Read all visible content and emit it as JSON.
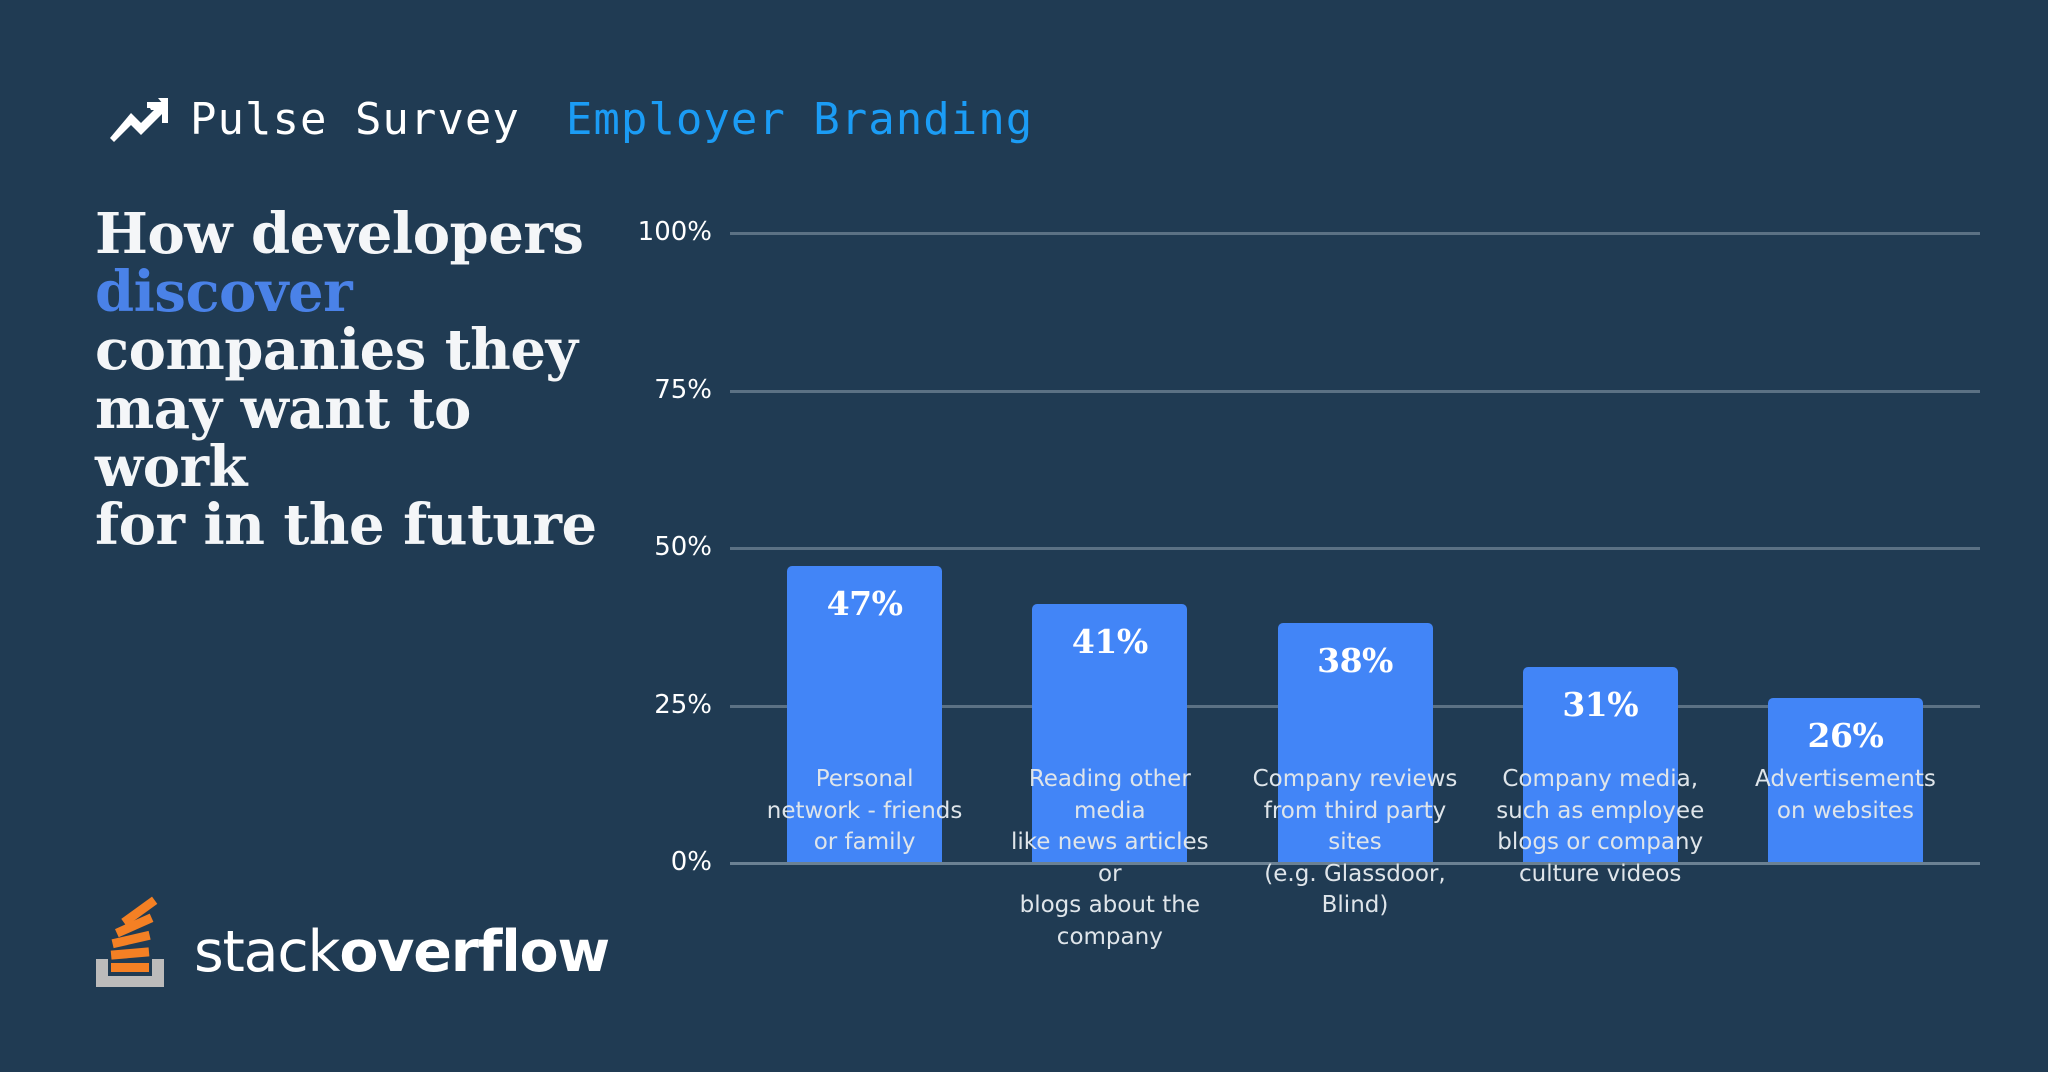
{
  "background_color": "#203b53",
  "header": {
    "icon": "trend-up-arrow-icon",
    "title_main": "Pulse Survey",
    "title_accent": "Employer Branding",
    "accent_color": "#1b9cf5"
  },
  "headline": {
    "line1": "How developers",
    "accent_word": "discover",
    "line3": "companies they",
    "line4": "may want to work",
    "line5": "for in the future",
    "accent_color": "#4a82e8"
  },
  "logo": {
    "mark": "stack-overflow-logo-icon",
    "word_light": "stack",
    "word_bold": "overflow",
    "orange": "#f48024",
    "gray": "#bcbbbb"
  },
  "chart_data": {
    "type": "bar",
    "title": "How developers discover companies they may want to work for in the future",
    "xlabel": "",
    "ylabel": "",
    "ylim": [
      0,
      100
    ],
    "grid": true,
    "legend": "none",
    "bar_color": "#4285f7",
    "yticks": [
      "100%",
      "75%",
      "50%",
      "25%",
      "0%"
    ],
    "ytick_values": [
      100,
      75,
      50,
      25,
      0
    ],
    "categories": [
      "Personal network - friends or family",
      "Reading other media like news articles or blogs about the company",
      "Company reviews from third party sites (e.g. Glassdoor, Blind)",
      "Company media, such as employee blogs or company culture videos",
      "Advertisements on websites"
    ],
    "category_lines": [
      [
        "Personal",
        "network - friends",
        "or family"
      ],
      [
        "Reading other media",
        "like news articles or",
        "blogs about the",
        "company"
      ],
      [
        "Company reviews",
        "from third party sites",
        "(e.g. Glassdoor,",
        "Blind)"
      ],
      [
        "Company media,",
        "such as employee",
        "blogs or company",
        "culture videos"
      ],
      [
        "Advertisements",
        "on websites"
      ]
    ],
    "values": [
      47,
      41,
      38,
      31,
      26
    ],
    "value_labels": [
      "47%",
      "41%",
      "38%",
      "31%",
      "26%"
    ]
  }
}
